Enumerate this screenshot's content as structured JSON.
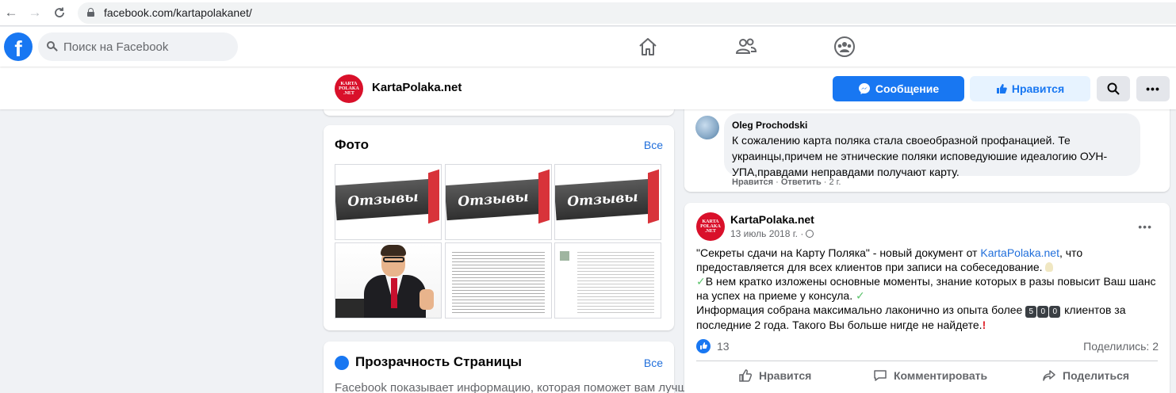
{
  "browser": {
    "url": "facebook.com/kartapolakanet/"
  },
  "fbnav": {
    "search_placeholder": "Поиск на Facebook"
  },
  "page": {
    "avatar_lines": [
      "KARTA",
      "POLAKA",
      ".NET"
    ],
    "name": "KartaPolaka.net",
    "message_btn": "Сообщение",
    "like_btn": "Нравится"
  },
  "photos": {
    "title": "Фото",
    "see_all": "Все",
    "otzyvy_text": "Отзывы"
  },
  "transparency": {
    "title": "Прозрачность Страницы",
    "see_all": "Все",
    "text": "Facebook показывает информацию, которая поможет вам лучше"
  },
  "comment": {
    "author": "Oleg Prochodski",
    "text": "К сожалению карта поляка стала своеобразной профанацией. Те украинцы,причем не этнические поляки исповедуюшие идеалогию ОУН-УПА,правдами неправдами получают карту.",
    "like": "Нравится",
    "reply": "Ответить",
    "age": "2 г."
  },
  "post": {
    "author": "KartaPolaka.net",
    "date": "13 июль 2018 г. ·",
    "text_p1_before_link": "\"Секреты сдачи на Карту Поляка\" - новый документ от ",
    "text_p1_link": "KartaPolaka.net",
    "text_p1_after_link": ", что предоставляется для всех клиентов при записи на собеседование.",
    "text_p2": "В нем кратко изложены основные моменты, знание которых в разы повысит Ваш шанс на успех на приеме у консула.",
    "text_p3_before": "Информация собрана максимально лаконично из опыта более ",
    "text_p3_digits": [
      "5",
      "0",
      "0"
    ],
    "text_p3_after": " клиентов за последние 2 года. Такого Вы больше нигде не найдете.",
    "likes": "13",
    "shares": "Поделились: 2",
    "action_like": "Нравится",
    "action_comment": "Комментировать",
    "action_share": "Поделиться"
  },
  "colors": {
    "fb_blue": "#1877f2",
    "brand_red": "#d9102a",
    "link": "#216fdb"
  },
  "icons": [
    "back-arrow",
    "forward-arrow",
    "reload",
    "lock",
    "facebook-logo",
    "search",
    "home",
    "friends",
    "groups",
    "messenger",
    "thumbs-up",
    "more-dots",
    "globe",
    "comment",
    "share"
  ]
}
